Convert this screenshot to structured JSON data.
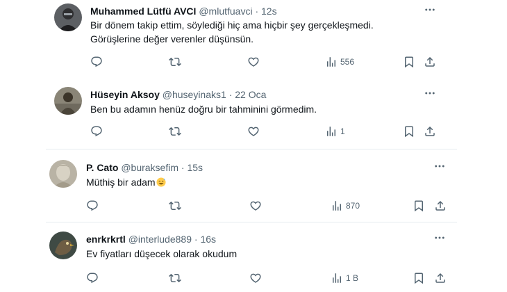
{
  "tweets": [
    {
      "name": "Muhammed Lütfü AVCI",
      "handle": "@mlutfuavci",
      "dot": "·",
      "time": "12s",
      "lines": [
        "Bir dönem takip ettim, söylediği hiç ama hiçbir şey gerçekleşmedi.",
        "Görüşlerine değer verenler düşünsün."
      ],
      "views": "556"
    },
    {
      "name": "Hüseyin Aksoy",
      "handle": "@huseyinaks1",
      "dot": "·",
      "time": "22 Oca",
      "lines": [
        "Ben bu adamın henüz doğru bir tahminini görmedim."
      ],
      "views": "1"
    },
    {
      "name": "P. Cato",
      "handle": "@buraksefim",
      "dot": "·",
      "time": "15s",
      "lines": [
        "Müthiş bir adam"
      ],
      "emoji": "sweat-smile-emoji",
      "views": "870"
    },
    {
      "name": "enrkrkrtl",
      "handle": "@interlude889",
      "dot": "·",
      "time": "16s",
      "lines": [
        "Ev fiyatları düşecek olarak okudum"
      ],
      "views": "1 B"
    }
  ],
  "icons": {
    "reply": "reply-icon",
    "retweet": "retweet-icon",
    "like": "like-icon",
    "views": "views-icon",
    "bookmark": "bookmark-icon",
    "share": "share-icon",
    "more": "more-options-icon"
  },
  "colors": {
    "text": "#0f1419",
    "secondary": "#536471",
    "divider": "#e6ecf0"
  }
}
